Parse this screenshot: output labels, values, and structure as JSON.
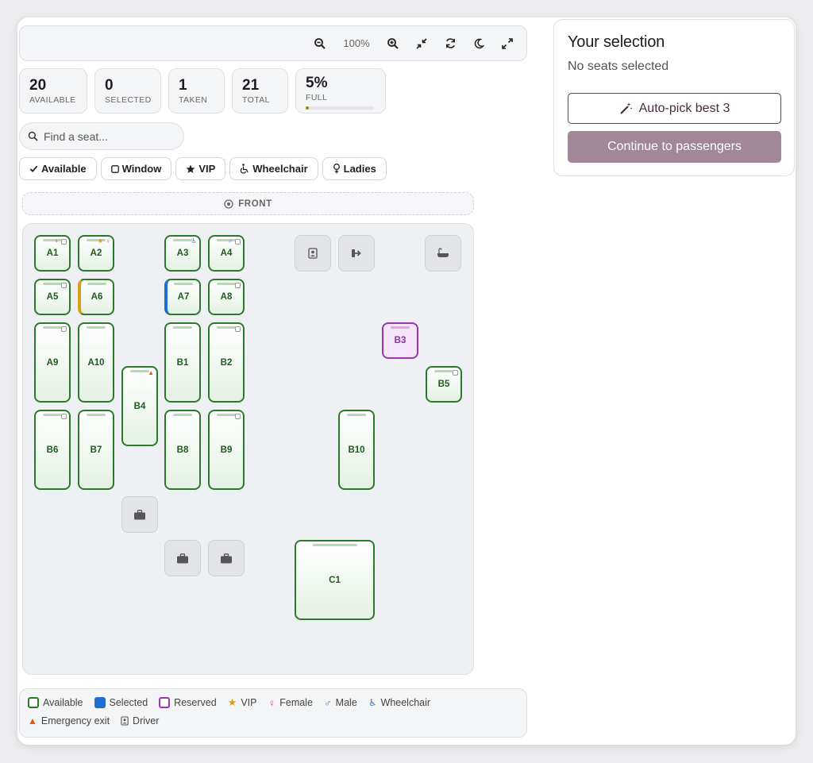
{
  "toolbar": {
    "zoom": "100%",
    "icons": [
      "zoom-out-icon",
      "zoom-in-icon",
      "shrink-icon",
      "refresh-icon",
      "moon-icon",
      "fullscreen-icon"
    ]
  },
  "stats": {
    "available": {
      "value": "20",
      "label": "AVAILABLE"
    },
    "selected": {
      "value": "0",
      "label": "SELECTED"
    },
    "taken": {
      "value": "1",
      "label": "TAKEN"
    },
    "total": {
      "value": "21",
      "label": "TOTAL"
    },
    "full": {
      "value": "5%",
      "label": "FULL",
      "fraction": 0.05
    }
  },
  "search": {
    "placeholder": "Find a seat..."
  },
  "filters": {
    "available": "Available",
    "window": "Window",
    "vip": "VIP",
    "wheelchair": "Wheelchair",
    "ladies": "Ladies"
  },
  "front_label": "FRONT",
  "seats": {
    "A1": "A1",
    "A2": "A2",
    "A3": "A3",
    "A4": "A4",
    "A5": "A5",
    "A6": "A6",
    "A7": "A7",
    "A8": "A8",
    "A9": "A9",
    "A10": "A10",
    "B1": "B1",
    "B2": "B2",
    "B3": "B3",
    "B4": "B4",
    "B5": "B5",
    "B6": "B6",
    "B7": "B7",
    "B8": "B8",
    "B9": "B9",
    "B10": "B10",
    "C1": "C1"
  },
  "seat_status": {
    "B3": "reserved"
  },
  "legend": {
    "available": "Available",
    "selected": "Selected",
    "reserved": "Reserved",
    "vip": "VIP",
    "female": "Female",
    "male": "Male",
    "wheelchair": "Wheelchair",
    "emergency": "Emergency exit",
    "driver": "Driver"
  },
  "colors": {
    "available": "#2a7a2a",
    "selected": "#1f6fd1",
    "reserved": "#9b35b5",
    "vip": "#d4a017",
    "female": "#e0457b",
    "male": "#3b7fd8",
    "wheelchair": "#3b7fd8",
    "emergency": "#e0561e",
    "accent": "#6b3a55"
  },
  "panel": {
    "title": "Your selection",
    "empty": "No seats selected",
    "auto_pick": "Auto-pick best 3",
    "continue": "Continue to passengers"
  }
}
